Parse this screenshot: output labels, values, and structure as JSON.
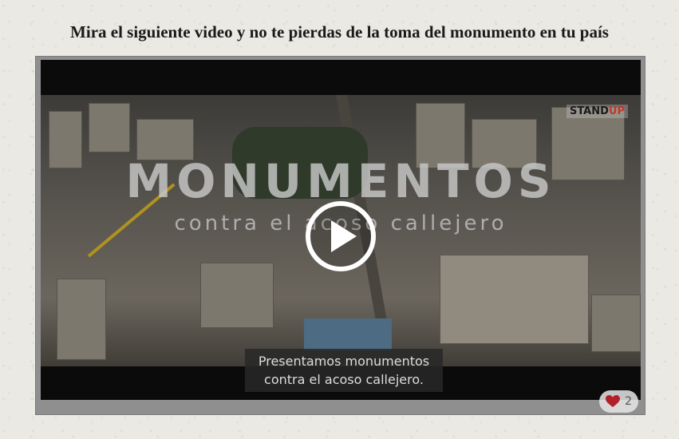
{
  "page": {
    "headline": "Mira el siguiente video y no te pierdas de la toma del monumento en tu país"
  },
  "video": {
    "title_main": "MONUMENTOS",
    "title_sub": "contra el acoso callejero",
    "logo_text": "STAND",
    "logo_accent": "UP",
    "caption_line1": "Presentamos monumentos",
    "caption_line2": "contra el acoso callejero.",
    "play_icon": "play-icon"
  },
  "reactions": {
    "like_icon": "heart-icon",
    "like_count": "2",
    "like_color": "#b3202a"
  }
}
